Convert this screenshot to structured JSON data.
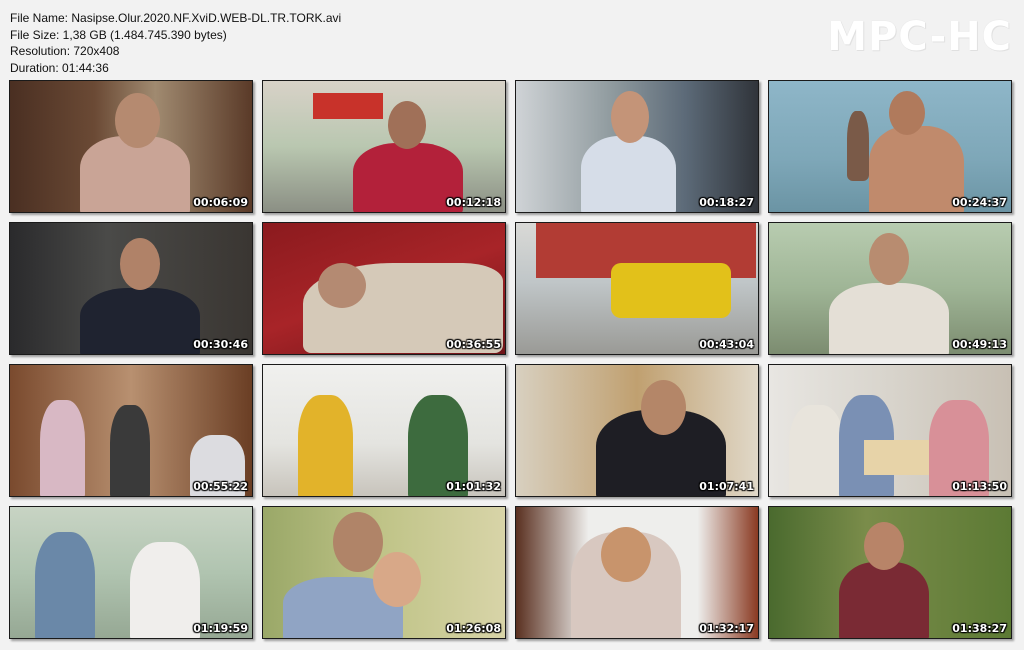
{
  "file_info": {
    "name": "File Name: Nasipse.Olur.2020.NF.XviD.WEB-DL.TR.TORK.avi",
    "size": "File Size: 1,38 GB (1.484.745.390 bytes)",
    "resolution": "Resolution: 720x408",
    "duration": "Duration: 01:44:36"
  },
  "brand": "MPC-HC",
  "thumbnails": [
    {
      "timestamp": "00:06:09"
    },
    {
      "timestamp": "00:12:18"
    },
    {
      "timestamp": "00:18:27"
    },
    {
      "timestamp": "00:24:37"
    },
    {
      "timestamp": "00:30:46"
    },
    {
      "timestamp": "00:36:55"
    },
    {
      "timestamp": "00:43:04"
    },
    {
      "timestamp": "00:49:13"
    },
    {
      "timestamp": "00:55:22"
    },
    {
      "timestamp": "01:01:32"
    },
    {
      "timestamp": "01:07:41"
    },
    {
      "timestamp": "01:13:50"
    },
    {
      "timestamp": "01:19:59"
    },
    {
      "timestamp": "01:26:08"
    },
    {
      "timestamp": "01:32:17"
    },
    {
      "timestamp": "01:38:27"
    }
  ]
}
